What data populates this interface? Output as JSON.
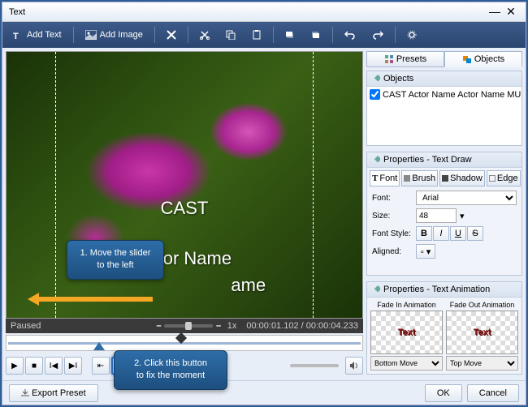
{
  "window": {
    "title": "Text"
  },
  "toolbar": {
    "addText": "Add Text",
    "addImage": "Add Image"
  },
  "tabs": {
    "presets": "Presets",
    "objects": "Objects"
  },
  "objectsPanel": {
    "title": "Objects",
    "item": "CAST  Actor Name Actor Name  MUSIC  Music by Na..."
  },
  "propsText": {
    "title": "Properties - Text Draw",
    "tabs": {
      "font": "Font",
      "brush": "Brush",
      "shadow": "Shadow",
      "edge": "Edge"
    },
    "fontLabel": "Font:",
    "fontValue": "Arial",
    "sizeLabel": "Size:",
    "sizeValue": "48",
    "styleLabel": "Font Style:",
    "alignLabel": "Aligned:"
  },
  "propsAnim": {
    "title": "Properties - Text Animation",
    "fadeIn": "Fade In Animation",
    "fadeOut": "Fade Out Animation",
    "sample": "Text",
    "bottomMove": "Bottom Move",
    "topMove": "Top Move"
  },
  "overlay": {
    "t1": "CAST",
    "t2": "Actor Name",
    "t3": "ame"
  },
  "status": {
    "paused": "Paused",
    "speed": "1x",
    "cur": "00:00:01.102",
    "total": "00:00:04.233"
  },
  "footer": {
    "export": "Export Preset",
    "ok": "OK",
    "cancel": "Cancel"
  },
  "callouts": {
    "c1": "1. Move the slider\nto the left",
    "c2": "2. Click this button\nto fix the moment"
  }
}
